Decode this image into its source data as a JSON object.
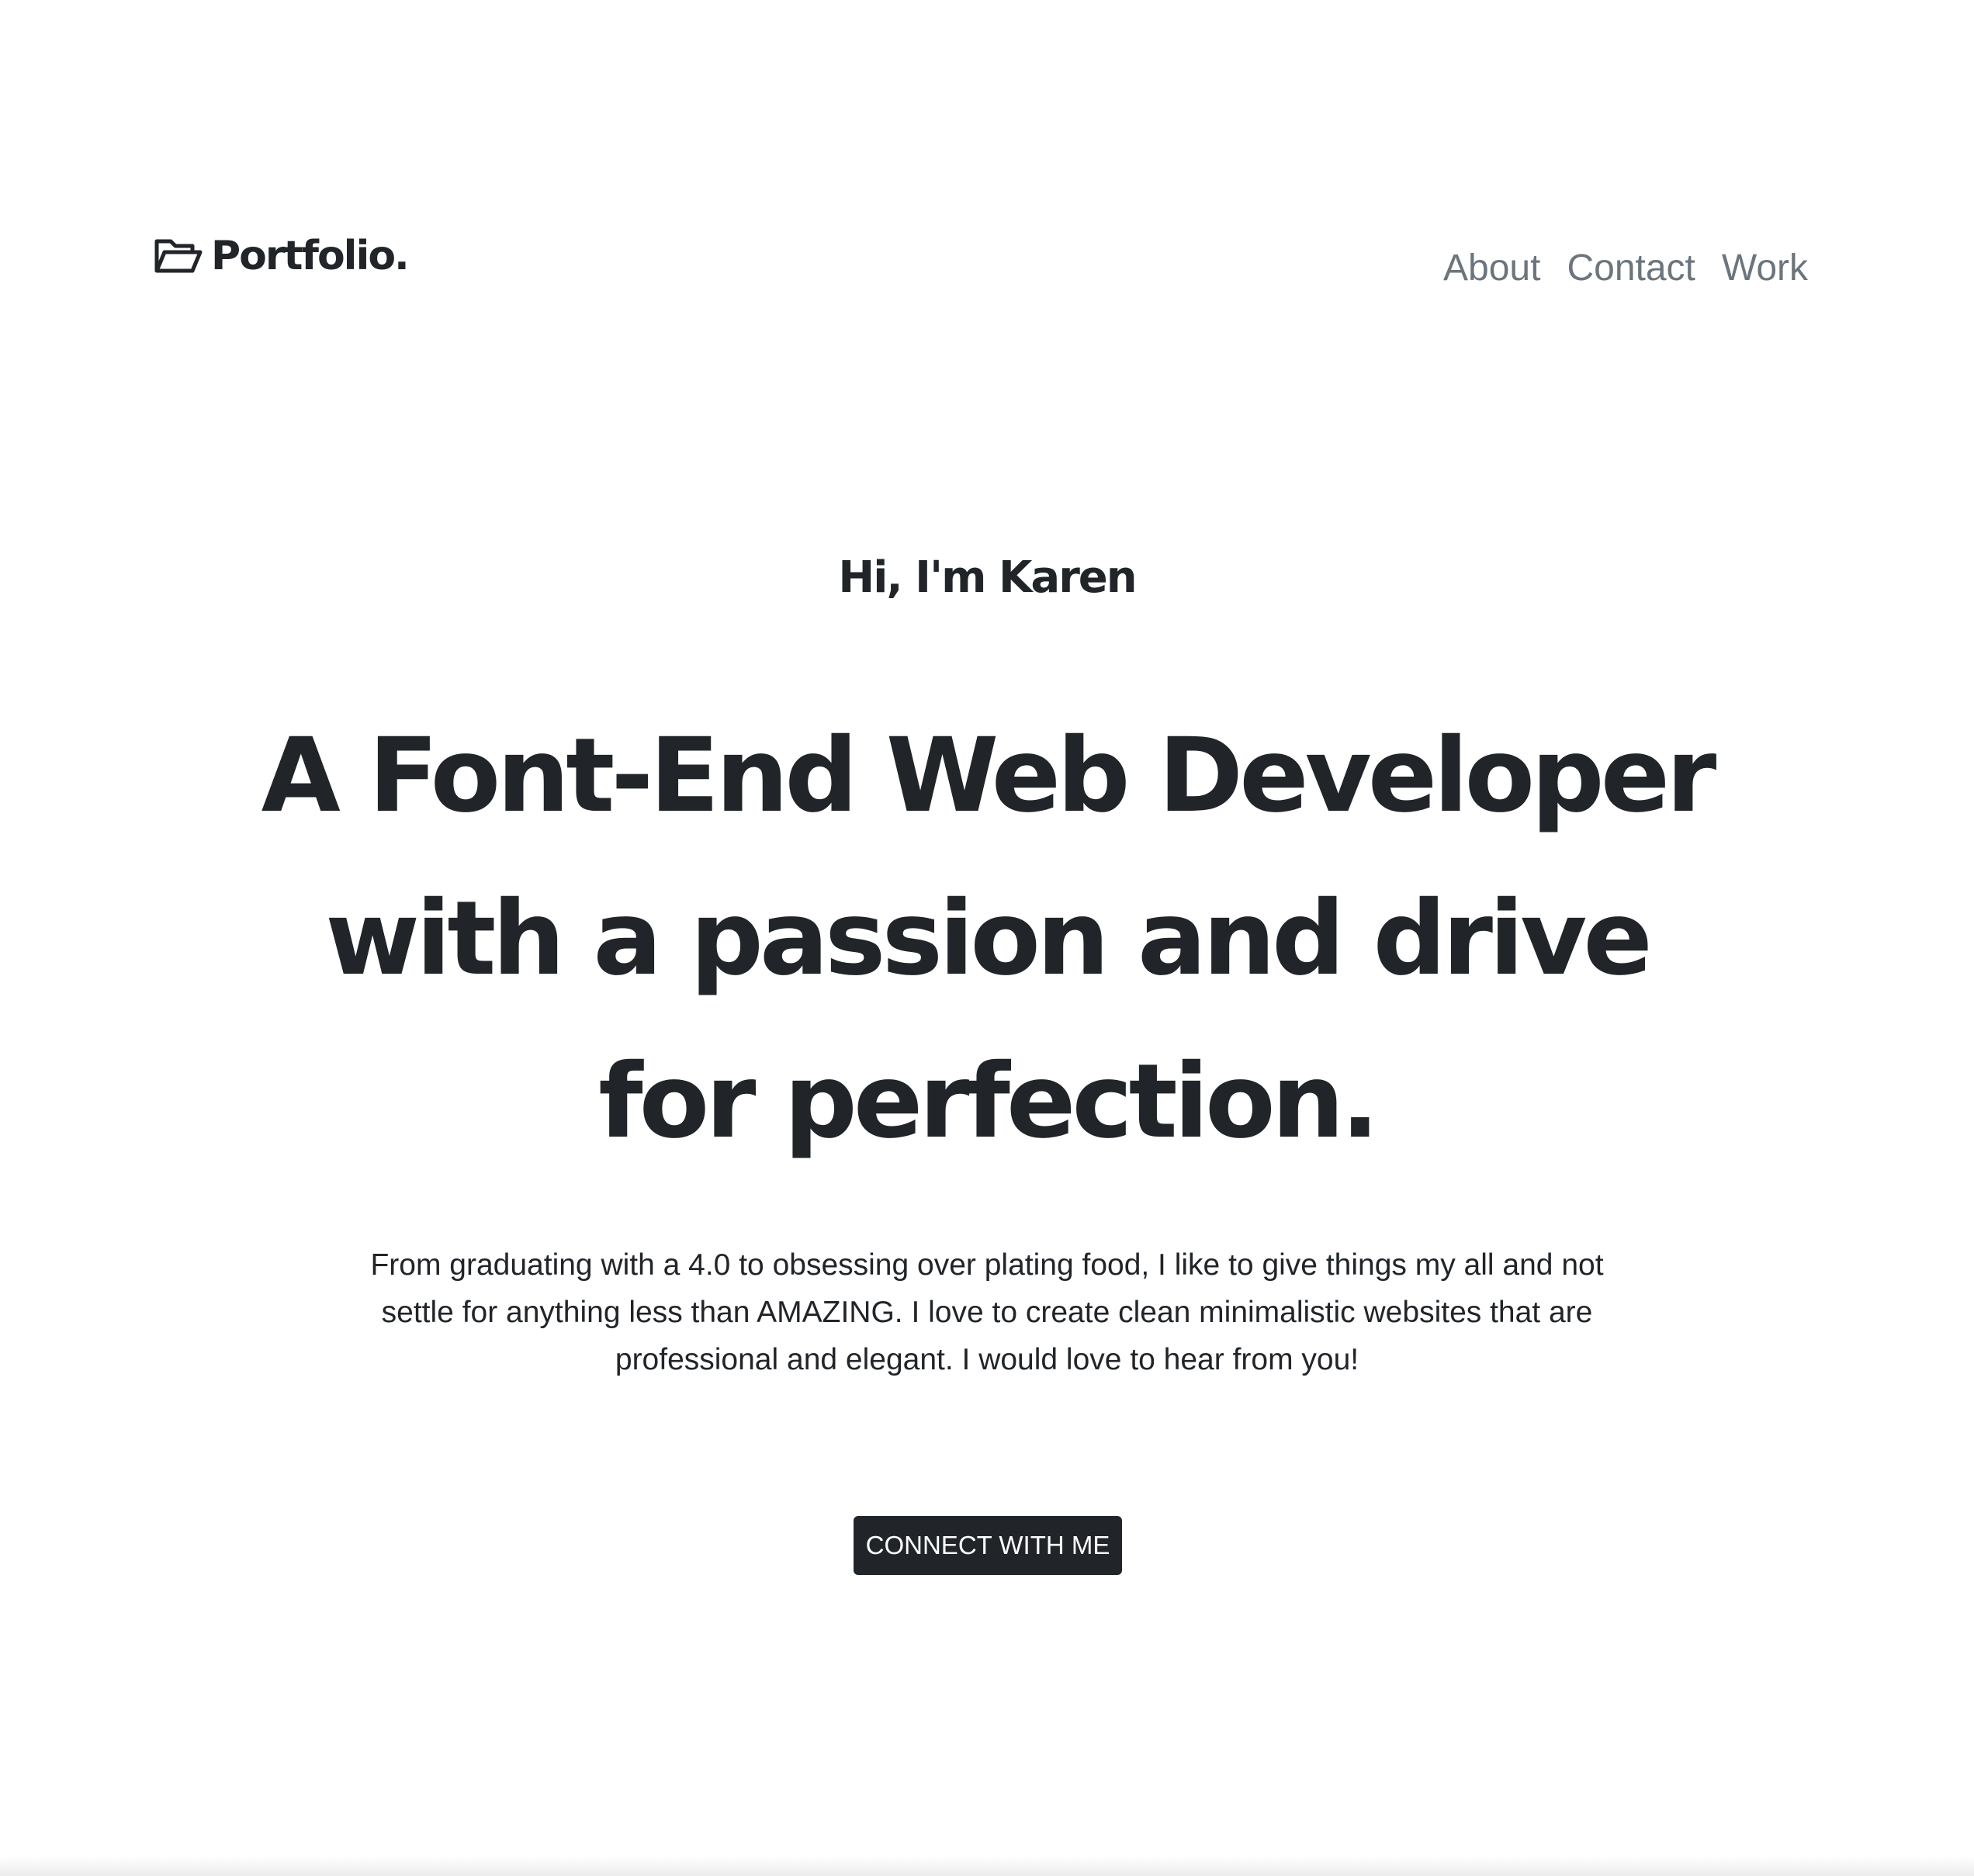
{
  "navbar": {
    "brand": {
      "icon": "folder-open-icon",
      "label": "Portfolio."
    },
    "links": [
      {
        "label": "About"
      },
      {
        "label": "Contact"
      },
      {
        "label": "Work"
      }
    ]
  },
  "hero": {
    "greeting": "Hi, I'm Karen",
    "headline": "A Font-End Web Developer with a passion and drive for perfection.",
    "description": "From graduating with a 4.0 to obsessing over plating food, I like to give things my all and not settle for anything less than AMAZING. I love to create clean minimalistic websites that are professional and elegant. I would love to hear from you!",
    "cta_label": "CONNECT WITH ME"
  },
  "colors": {
    "text": "#212529",
    "nav_link": "#6c757d",
    "button_bg": "#212529",
    "button_text": "#ffffff",
    "background": "#ffffff"
  }
}
